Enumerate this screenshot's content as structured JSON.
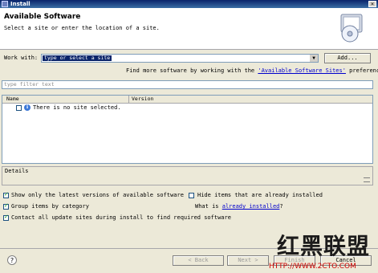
{
  "window": {
    "title": "Install"
  },
  "header": {
    "title": "Available Software",
    "subtitle": "Select a site or enter the location of a site."
  },
  "work_with": {
    "label": "Work with:",
    "value": "type or select a site",
    "add_label": "Add..."
  },
  "find_more": {
    "prefix": "Find more software by working with the",
    "link": "'Available Software Sites'",
    "suffix": "preferences."
  },
  "filter": {
    "placeholder": "type filter text"
  },
  "table": {
    "columns": [
      "Name",
      "Version"
    ],
    "rows": [
      {
        "name": "There is no site selected.",
        "checked": false
      }
    ]
  },
  "details": {
    "label": "Details"
  },
  "options": {
    "show_latest": {
      "label": "Show only the latest versions of available software",
      "checked": true
    },
    "hide_installed": {
      "label": "Hide items that are already installed",
      "checked": false
    },
    "group_by_category": {
      "label": "Group items by category",
      "checked": true
    },
    "what_is_prefix": "What is",
    "what_is_link": "already installed",
    "what_is_suffix": "?",
    "contact_all": {
      "label": "Contact all update sites during install to find required software",
      "checked": true
    }
  },
  "buttons": {
    "back": "< Back",
    "next": "Next >",
    "finish": "Finish",
    "cancel": "Cancel"
  },
  "watermark": {
    "logo": "红黑联盟",
    "url": "HTTP://WWW.2CTO.COM"
  },
  "colors": {
    "title_bar": "#0a246a",
    "link": "#0000cc",
    "selection": "#0a246a",
    "watermark_url": "#cc0000"
  },
  "icons": {
    "window": "eclipse-install-icon",
    "banner": "software-cd-icon",
    "info": "info-icon",
    "help": "help-icon"
  }
}
